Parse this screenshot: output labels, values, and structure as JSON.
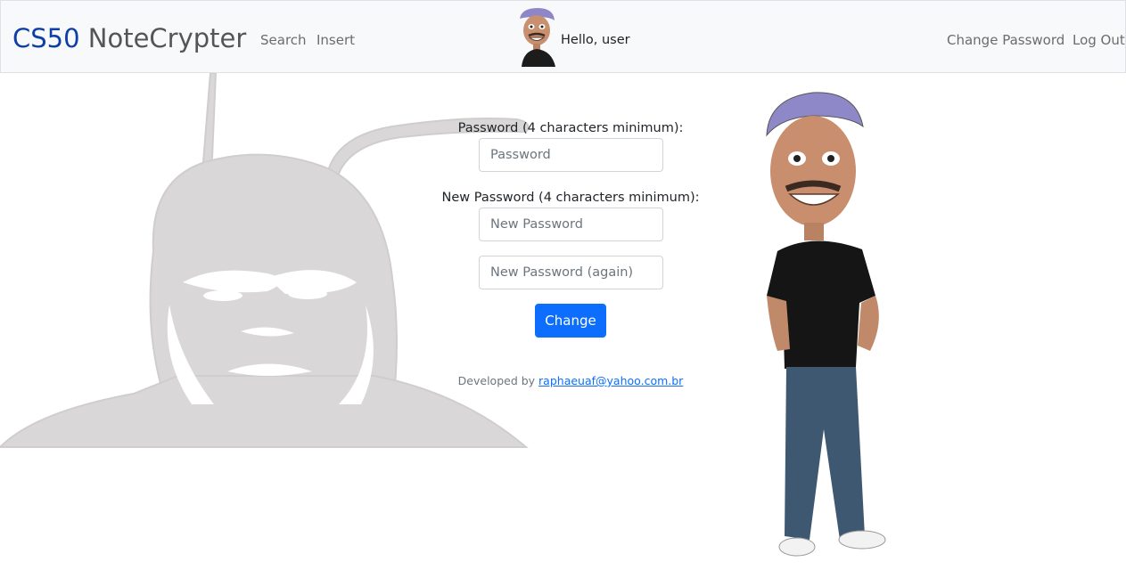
{
  "navbar": {
    "brand_part1": "CS50",
    "brand_part2": "NoteCrypter",
    "links": {
      "search": "Search",
      "insert": "Insert"
    },
    "greeting": "Hello, user",
    "right_links": {
      "change_password": "Change Password",
      "log_out": "Log Out"
    }
  },
  "form": {
    "password_label": "Password (4 characters minimum):",
    "password_placeholder": "Password",
    "new_password_label": "New Password (4 characters minimum):",
    "new_password_placeholder": "New Password",
    "new_password_again_placeholder": "New Password (again)",
    "submit_label": "Change"
  },
  "footer": {
    "prefix": "Developed by",
    "email": "raphaeuaf@yahoo.com.br"
  },
  "colors": {
    "brand_blue": "#0d3fa6",
    "primary_button": "#0d6efd",
    "navbar_bg": "#f8f9fa",
    "background_sketch": "#d9d7d7"
  }
}
